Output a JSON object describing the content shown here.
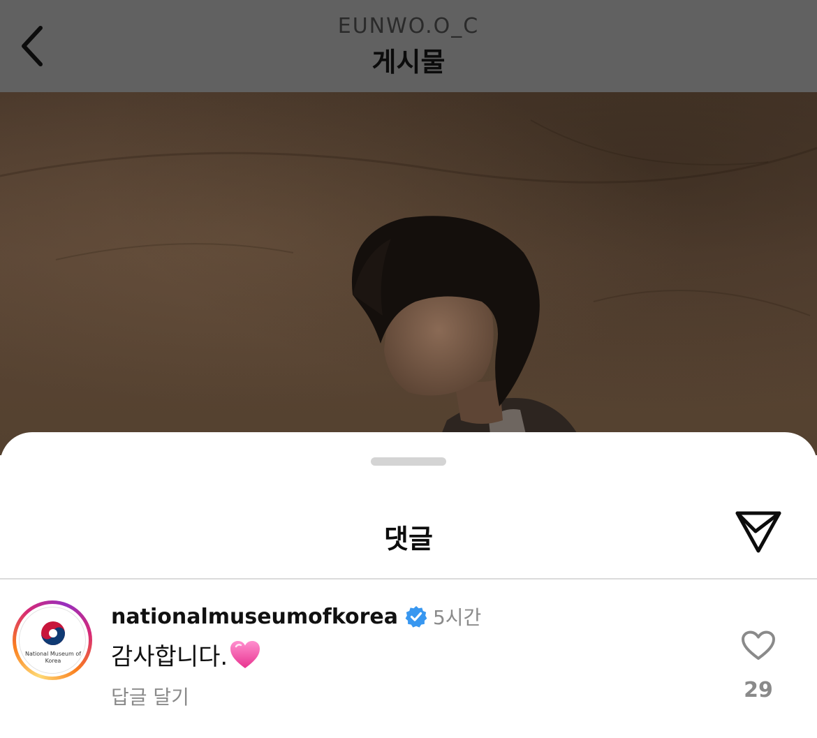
{
  "header": {
    "username": "EUNWO.O_C",
    "title": "게시물"
  },
  "sheet": {
    "title": "댓글"
  },
  "comment": {
    "username": "nationalmuseumofkorea",
    "time": "5시간",
    "text": "감사합니다.",
    "reply_label": "답글 달기",
    "like_count": "29",
    "avatar_text": "National Museum of Korea"
  },
  "icons": {
    "back": "chevron-left-icon",
    "share": "paper-plane-icon",
    "verified": "verified-badge-icon",
    "like": "heart-outline-icon",
    "emoji": "pink-heart-emoji"
  },
  "colors": {
    "verified_blue": "#3897f0",
    "muted_text": "#8a8a8a",
    "header_dim": "#616161"
  }
}
